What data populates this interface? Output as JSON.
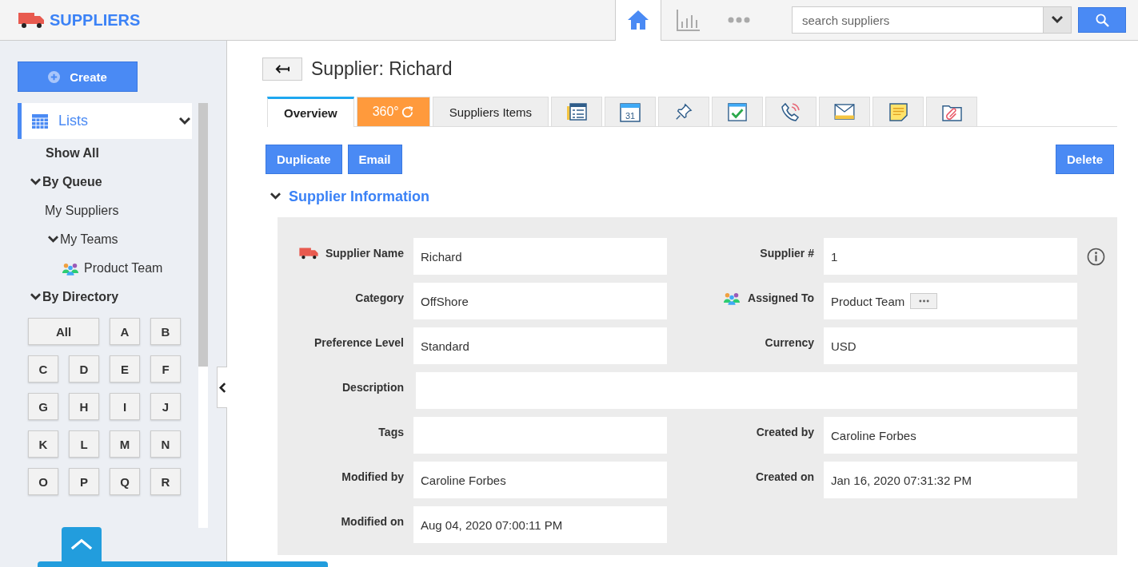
{
  "header": {
    "title": "SUPPLIERS",
    "nav": [
      {
        "kind": "home",
        "selected": true
      },
      {
        "kind": "chart",
        "selected": false
      },
      {
        "kind": "more",
        "selected": false
      }
    ],
    "search": {
      "placeholder": "search suppliers"
    }
  },
  "sidebar": {
    "create_button": "Create",
    "lists": {
      "label": "Lists",
      "expanded": true
    },
    "tree": [
      {
        "label": "Show All"
      },
      {
        "label": "By Queue",
        "expanded": true,
        "children": [
          {
            "label": "My Suppliers"
          },
          {
            "label": "My Teams",
            "expanded": true,
            "children": [
              {
                "label": "Product Team",
                "kind": "team"
              }
            ]
          }
        ]
      },
      {
        "label": "By Directory",
        "expanded": true
      }
    ],
    "letters": [
      "All",
      "A",
      "B",
      "C",
      "D",
      "E",
      "F",
      "G",
      "H",
      "I",
      "J",
      "K",
      "L",
      "M",
      "N",
      "O",
      "P",
      "Q",
      "R"
    ]
  },
  "page": {
    "title": "Supplier: Richard"
  },
  "tabs": [
    {
      "kind": "text",
      "label": "Overview",
      "selected": true
    },
    {
      "kind": "rotate",
      "label": "360°",
      "selected": false
    },
    {
      "kind": "text",
      "label": "Suppliers Items",
      "selected": false
    },
    {
      "kind": "form",
      "selected": false
    },
    {
      "kind": "calendar",
      "label": "31",
      "selected": false
    },
    {
      "kind": "pin",
      "selected": false
    },
    {
      "kind": "task",
      "selected": false
    },
    {
      "kind": "phone",
      "selected": false
    },
    {
      "kind": "mail",
      "selected": false
    },
    {
      "kind": "note",
      "selected": false
    },
    {
      "kind": "attachment",
      "selected": false
    }
  ],
  "actions": [
    "Duplicate",
    "Email"
  ],
  "delete_button": "Delete",
  "section": {
    "title": "Supplier Information",
    "expanded": true
  },
  "rows": [
    {
      "kind": "pair",
      "info": true,
      "cells": [
        {
          "label": "Supplier Name",
          "kind": "truck",
          "value": "Richard"
        },
        {
          "label": "Supplier #",
          "value": "1"
        }
      ]
    },
    {
      "kind": "pair",
      "cells": [
        {
          "label": "Category",
          "value": "OffShore"
        },
        {
          "label": "Assigned To",
          "kind": "team",
          "value": "Product Team",
          "more": true
        }
      ]
    },
    {
      "kind": "pair",
      "cells": [
        {
          "label": "Preference Level",
          "value": "Standard"
        },
        {
          "label": "Currency",
          "value": "USD"
        }
      ]
    },
    {
      "kind": "wide",
      "cells": [
        {
          "label": "Description"
        }
      ]
    },
    {
      "kind": "pair",
      "cells": [
        {
          "label": "Tags"
        },
        {
          "label": "Created by",
          "value": "Caroline Forbes"
        }
      ]
    },
    {
      "kind": "pair",
      "cells": [
        {
          "label": "Modified by",
          "value": "Caroline Forbes"
        },
        {
          "label": "Created on",
          "value": "Jan 16, 2020 07:31:32 PM"
        }
      ]
    },
    {
      "kind": "pair",
      "cells": [
        {
          "label": "Modified on",
          "value": "Aug 04, 2020 07:00:11 PM"
        }
      ]
    }
  ]
}
